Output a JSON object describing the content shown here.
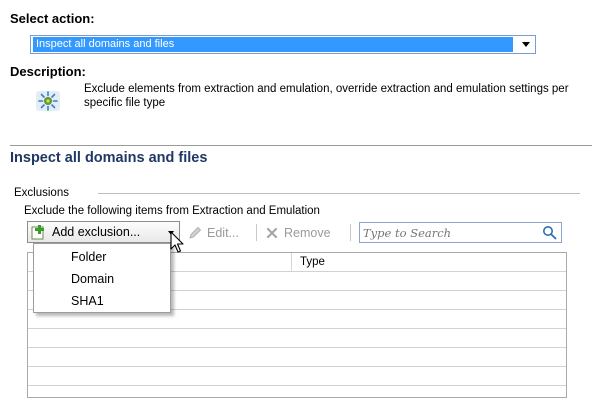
{
  "select_action": {
    "label": "Select action:",
    "value": "Inspect all domains and files"
  },
  "description": {
    "label": "Description:",
    "icon": "gear-star-icon",
    "text": "Exclude elements from extraction and emulation, override extraction and emulation settings per specific file type"
  },
  "section": {
    "heading": "Inspect all domains and files"
  },
  "exclusions": {
    "group_label": "Exclusions",
    "instruction": "Exclude the following items from Extraction and Emulation",
    "toolbar": {
      "add_label": "Add exclusion...",
      "edit_label": "Edit...",
      "remove_label": "Remove",
      "search_placeholder": "Type to Search"
    },
    "table": {
      "columns": [
        "",
        "Type"
      ],
      "rows": []
    },
    "add_menu": {
      "items": [
        "Folder",
        "Domain",
        "SHA1"
      ]
    }
  },
  "colors": {
    "selection": "#3399ff",
    "heading": "#1f3864",
    "disabled_text": "#9a9a9a"
  }
}
